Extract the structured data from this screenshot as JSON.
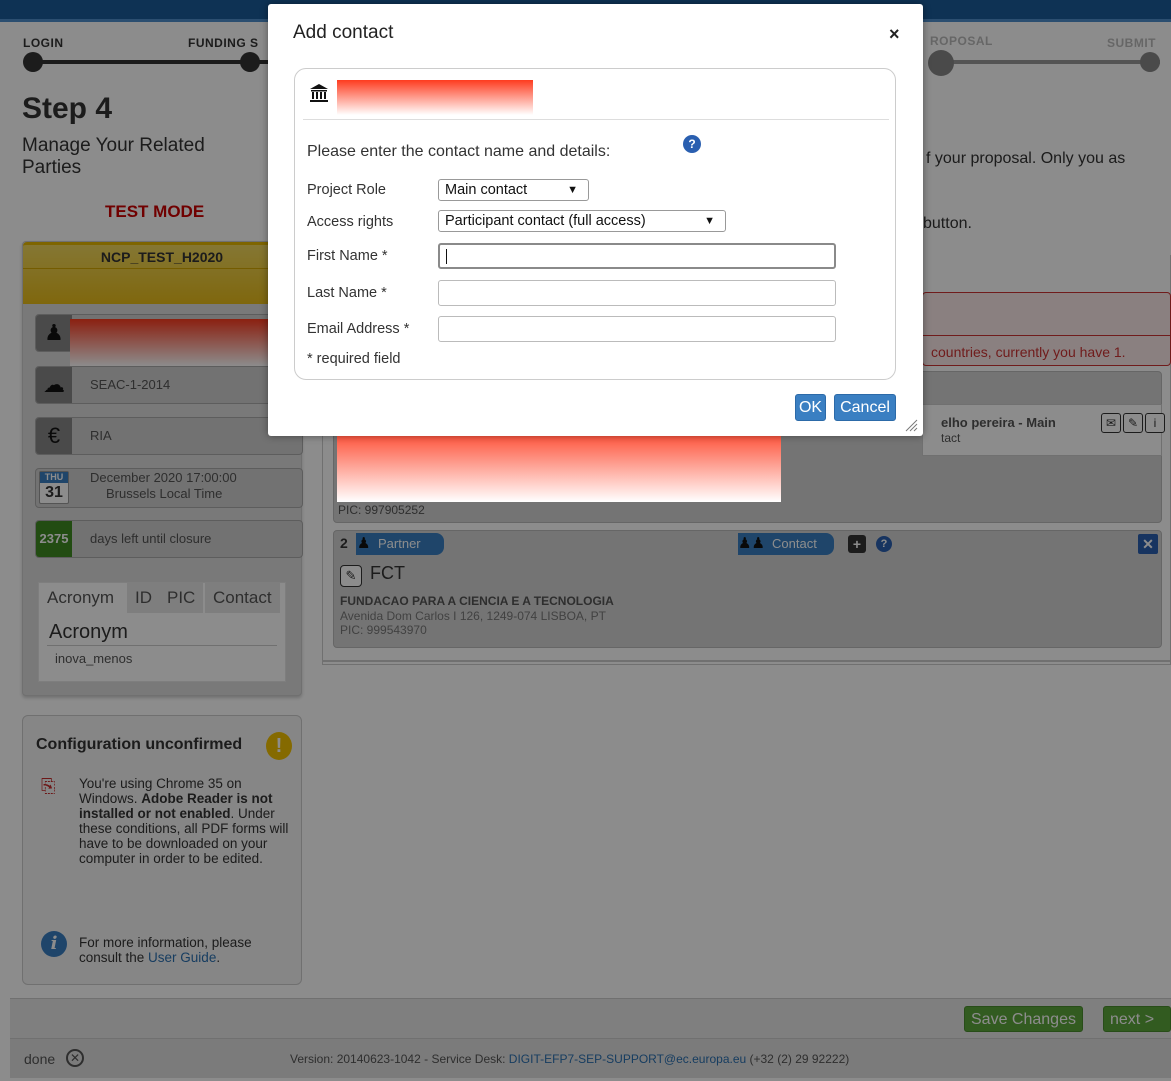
{
  "wizard": {
    "steps": [
      {
        "label": "LOGIN"
      },
      {
        "label": "FUNDING S"
      },
      {
        "label": "ROPOSAL"
      },
      {
        "label": "SUBMIT"
      }
    ]
  },
  "sidebar": {
    "step_title": "Step 4",
    "step_subtitle": "Manage Your Related Parties",
    "test_mode": "TEST MODE",
    "proposal_name": "NCP_TEST_H2020",
    "call": "SEAC-1-2014",
    "action_type": "RIA",
    "deadline_dow": "THU",
    "deadline_day": "31",
    "deadline_text": "December 2020 17:00:00",
    "deadline_tz": "Brussels Local Time",
    "days_left": "2375",
    "days_left_text": "days left until closure",
    "tabs": [
      "Acronym",
      "ID",
      "PIC",
      "Contact"
    ],
    "acronym_label": "Acronym",
    "acronym_value": "inova_menos",
    "config": {
      "title": "Configuration unconfirmed",
      "text_1": "You're using Chrome 35 on Windows. ",
      "text_bold": "Adobe Reader is not installed or not enabled",
      "text_2": ". Under these conditions, all PDF forms will have to be downloaded on your computer in order to be edited.",
      "more_1": "For more information, please consult the ",
      "more_link": "User Guide",
      "more_2": "."
    }
  },
  "main": {
    "text_1": "f your proposal. Only you as",
    "text_2": "button.",
    "alert": "countries, currently you have 1.",
    "partner1": {
      "contact_name": "elho pereira - Main",
      "contact_role": "tact",
      "pic": "PIC: 997905252"
    },
    "partner2": {
      "number": "2",
      "badge": "Partner",
      "contact_badge": "Contact",
      "acronym": "FCT",
      "name": "FUNDACAO PARA A CIENCIA E A TECNOLOGIA",
      "address": "Avenida Dom Carlos I 126, 1249-074 LISBOA, PT",
      "pic": "PIC: 999543970"
    }
  },
  "bottom": {
    "save_label": "Save Changes",
    "next_label": "next > >"
  },
  "status": {
    "done": "done",
    "version_text": "Version: 20140623-1042 - Service Desk: ",
    "email": "DIGIT-EFP7-SEP-SUPPORT@ec.europa.eu",
    "phone": " (+32 (2) 29 92222)"
  },
  "dialog": {
    "title": "Add contact",
    "close": "×",
    "prompt": "Please enter the contact name and details:",
    "project_role_label": "Project Role",
    "project_role_value": "Main contact",
    "access_rights_label": "Access rights",
    "access_rights_value": "Participant contact (full access)",
    "first_name_label": "First Name *",
    "last_name_label": "Last Name *",
    "email_label": "Email Address *",
    "first_name_value": "",
    "last_name_value": "",
    "email_value": "",
    "required_note": "* required field",
    "ok_label": "OK",
    "cancel_label": "Cancel"
  },
  "colors": {
    "accent_blue": "#3a7fc2",
    "green": "#5ca63b",
    "test_mode_red": "#cc0000",
    "proposal_yellow": "#e8bc1a"
  }
}
